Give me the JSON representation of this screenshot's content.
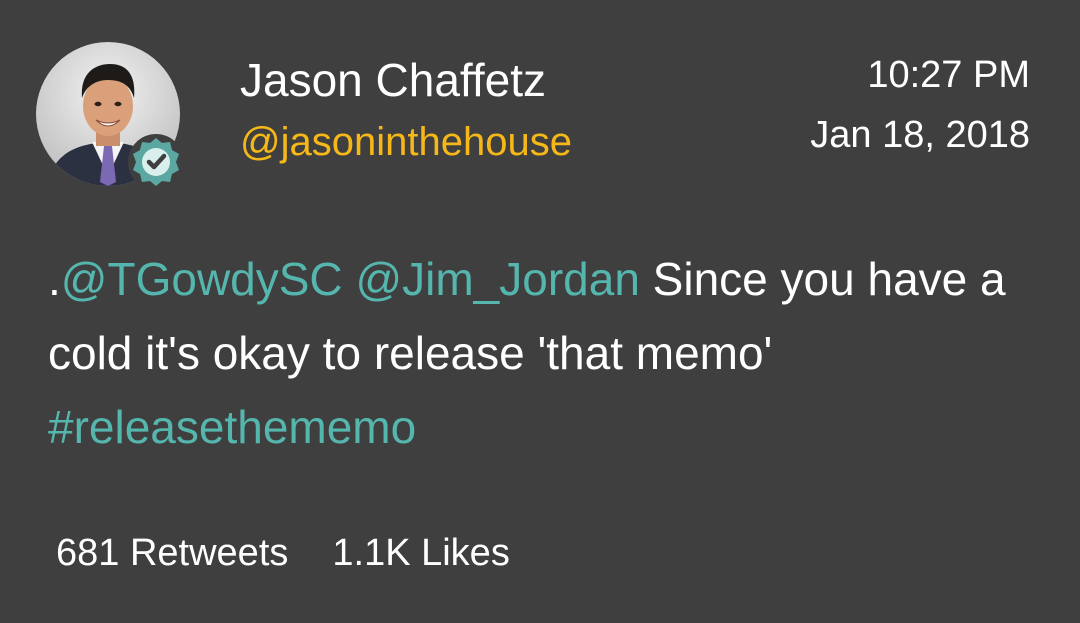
{
  "author": {
    "display_name": "Jason Chaffetz",
    "handle": "@jasoninthehouse",
    "verified": true
  },
  "meta": {
    "time": "10:27 PM",
    "date": "Jan 18, 2018"
  },
  "tweet": {
    "prefix": ".",
    "mention_1": "@TGowdySC",
    "mention_2": "@Jim_Jordan",
    "text_1": " Since you have a cold it's okay to release 'that memo'",
    "hashtag": "#releasethememo"
  },
  "stats": {
    "retweets_count": "681",
    "retweets_label": "Retweets",
    "likes_count": "1.1K",
    "likes_label": "Likes"
  },
  "colors": {
    "background": "#3f3f3f",
    "handle": "#f5b818",
    "link": "#55b6ad",
    "text": "#ffffff",
    "badge": "#5ba7a1"
  },
  "icons": {
    "avatar": "profile-photo",
    "verified": "verified-check-icon"
  }
}
